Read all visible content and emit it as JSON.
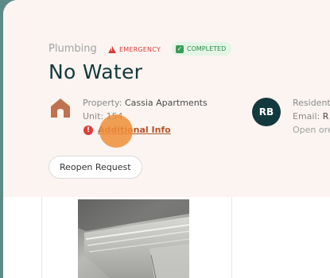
{
  "request": {
    "category": "Plumbing",
    "priority_label": "EMERGENCY",
    "status_label": "COMPLETED",
    "title": "No Water"
  },
  "property": {
    "property_label": "Property:",
    "property_value": "Cassia Apartments",
    "unit_label": "Unit:",
    "unit_value": "154",
    "additional_info": "Additional Info"
  },
  "resident": {
    "initials": "RB",
    "resident_label": "Resident",
    "email_label": "Email:",
    "email_value": "R",
    "open_text": "Open ore"
  },
  "actions": {
    "reopen_label": "Reopen Request"
  },
  "icons": {
    "property": "house-icon",
    "emergency": "warning-triangle-icon",
    "completed": "check-box-icon",
    "alert": "alert-circle-icon"
  },
  "colors": {
    "header_bg": "#fbf4f1",
    "title": "#123a3c",
    "emergency": "#d63c3c",
    "completed_bg": "#e4f5e7",
    "completed_text": "#2b8b45",
    "link": "#b2552a",
    "avatar_bg": "#123a3c",
    "house": "#c0714f"
  }
}
